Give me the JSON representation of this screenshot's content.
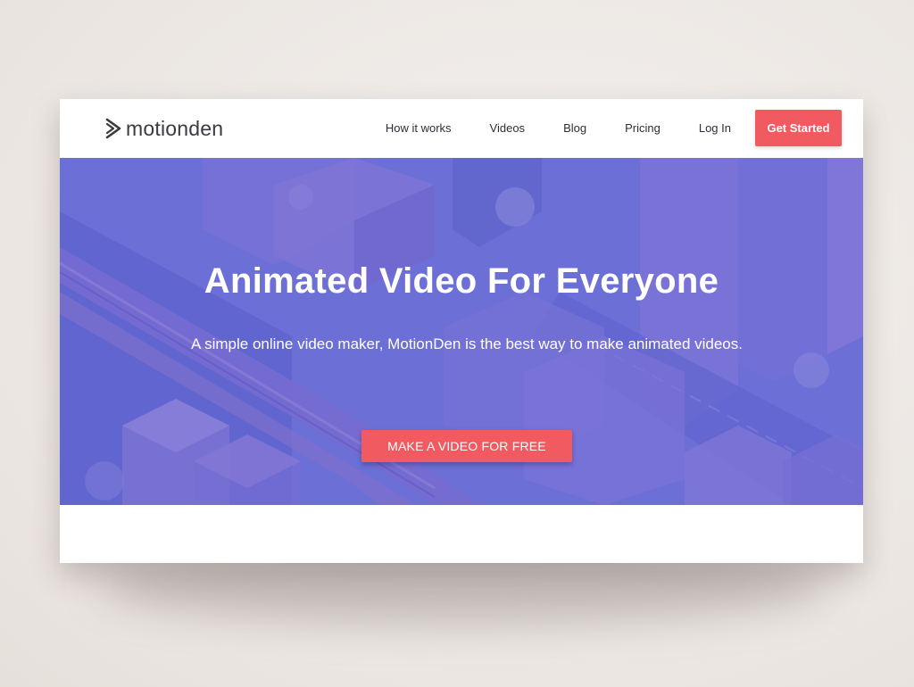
{
  "brand": {
    "name": "motionden",
    "logo_icon": "play-chevron-icon",
    "accent_color": "#f15a60",
    "hero_color": "#6b6fd8"
  },
  "nav": {
    "items": [
      {
        "label": "How it works"
      },
      {
        "label": "Videos"
      },
      {
        "label": "Blog"
      },
      {
        "label": "Pricing"
      },
      {
        "label": "Log In"
      }
    ],
    "cta_label": "Get Started"
  },
  "hero": {
    "title": "Animated Video For Everyone",
    "subtitle": "A simple online video maker, MotionDen is the best way to make animated videos.",
    "cta_label": "MAKE A VIDEO FOR FREE"
  }
}
